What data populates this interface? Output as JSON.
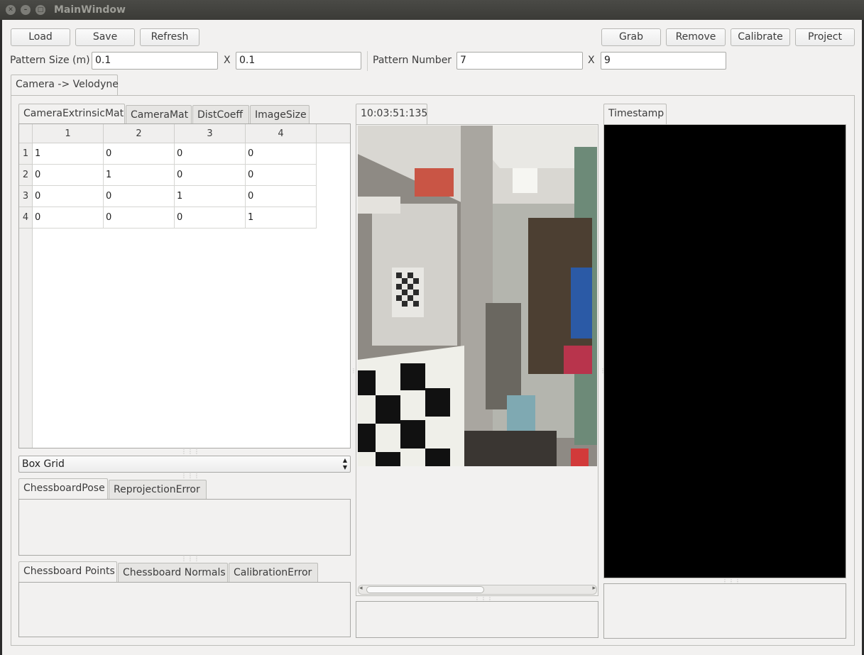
{
  "window": {
    "title": "MainWindow"
  },
  "toolbar": {
    "load_label": "Load",
    "save_label": "Save",
    "refresh_label": "Refresh",
    "grab_label": "Grab",
    "remove_label": "Remove",
    "calibrate_label": "Calibrate",
    "project_label": "Project"
  },
  "pattern": {
    "size_label": "Pattern Size (m)",
    "size_x": "0.1",
    "size_y": "0.1",
    "number_label": "Pattern Number",
    "number_x": "7",
    "number_y": "9",
    "x_separator": "X"
  },
  "main_tab": {
    "label": "Camera -> Velodyne"
  },
  "matrix_tabs": [
    "CameraExtrinsicMat",
    "CameraMat",
    "DistCoeff",
    "ImageSize"
  ],
  "matrix": {
    "column_headers": [
      "1",
      "2",
      "3",
      "4"
    ],
    "row_headers": [
      "1",
      "2",
      "3",
      "4"
    ],
    "rows": [
      [
        "1",
        "0",
        "0",
        "0"
      ],
      [
        "0",
        "1",
        "0",
        "0"
      ],
      [
        "0",
        "0",
        "1",
        "0"
      ],
      [
        "0",
        "0",
        "0",
        "1"
      ]
    ]
  },
  "combo": {
    "value": "Box Grid"
  },
  "pose_tabs": [
    "ChessboardPose",
    "ReprojectionError"
  ],
  "points_tabs": [
    "Chessboard Points",
    "Chessboard Normals",
    "CalibrationError"
  ],
  "camera_view": {
    "tab_label": "10:03:51:135"
  },
  "lidar_view": {
    "tab_label": "Timestamp"
  }
}
